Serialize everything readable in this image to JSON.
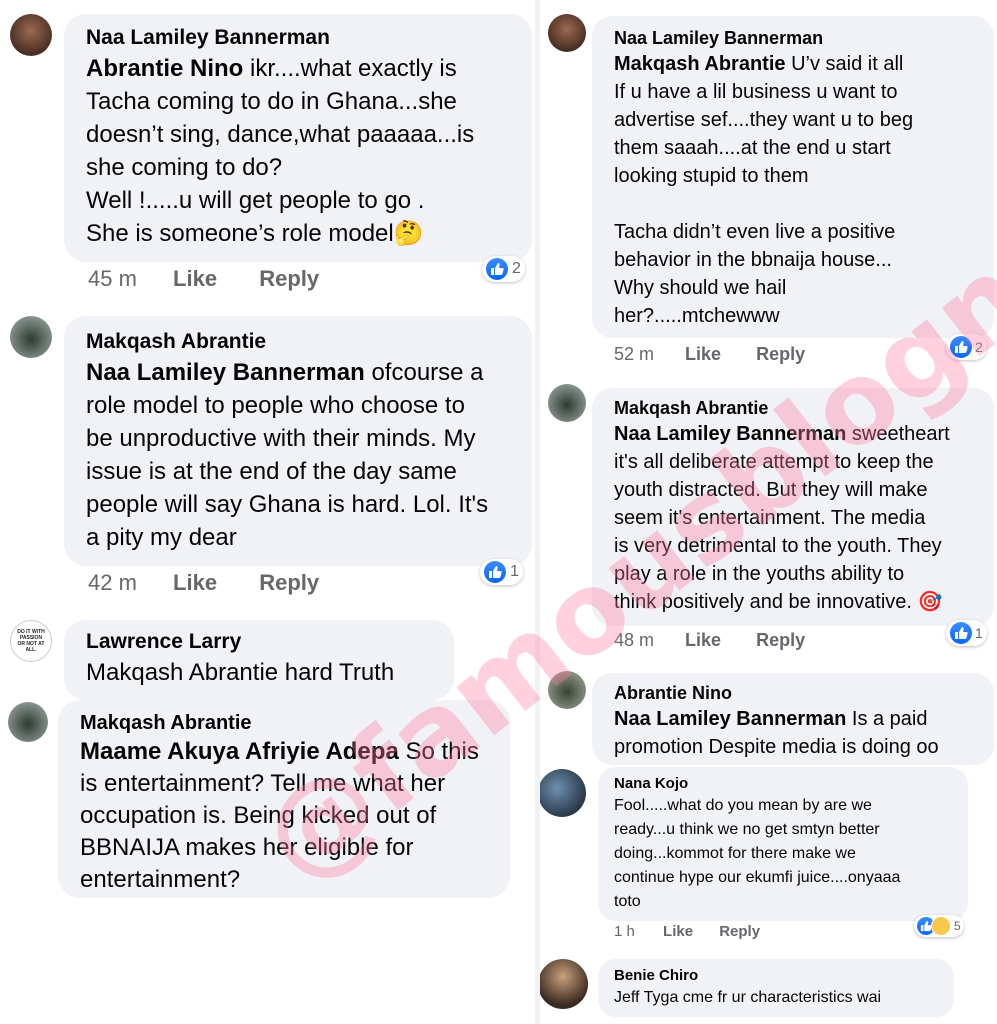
{
  "left": {
    "c1": {
      "author": "Naa Lamiley Bannerman",
      "mention": "Abrantie Nino",
      "text": " ikr....what exactly is\nTacha coming to do in Ghana...she\ndoesn’t sing, dance,what paaaaa...is\nshe coming to do?\nWell !.....u will get people to go .\nShe is someone’s role model🤔",
      "time": "45 m",
      "like": "Like",
      "reply": "Reply",
      "reactions": "2"
    },
    "c2": {
      "author": "Makqash Abrantie",
      "mention": "Naa Lamiley Bannerman",
      "text": " ofcourse a\nrole model to people who choose to\nbe unproductive with their minds. My\nissue is at the end of the day same\npeople will say Ghana is hard. Lol. It's\na pity my dear",
      "time": "42 m",
      "like": "Like",
      "reply": "Reply",
      "reactions": "1"
    },
    "c3": {
      "author": "Lawrence Larry",
      "text": "Makqash Abrantie hard Truth",
      "avatar_text": "DO IT WITH PASSION OR NOT AT ALL."
    },
    "c4": {
      "author": "Makqash Abrantie",
      "mention": "Maame Akuya Afriyie Adepa",
      "text": " So this\nis entertainment? Tell me what her\noccupation is. Being kicked out of\nBBNAIJA makes her eligible for\nentertainment?"
    }
  },
  "right": {
    "c1": {
      "author": "Naa Lamiley Bannerman",
      "mention": "Makqash Abrantie",
      "text": " U’v said it all\nIf u have a lil business u want to\nadvertise sef....they want u to beg\nthem saaah....at the end u start\nlooking stupid to them\n\nTacha didn’t even live a positive\nbehavior in the bbnaija house...\nWhy should we hail\nher?.....mtchewww",
      "time": "52 m",
      "like": "Like",
      "reply": "Reply",
      "reactions": "2"
    },
    "c2": {
      "author": "Makqash Abrantie",
      "mention": "Naa Lamiley Bannerman",
      "text": " sweetheart\nit's all deliberate attempt to keep the\nyouth distracted. But they will make\nseem it's entertainment. The media\nis very detrimental to the youth. They\nplay a role in the youths ability to\nthink positively and be innovative. 🎯",
      "time": "48 m",
      "like": "Like",
      "reply": "Reply",
      "reactions": "1"
    },
    "c3": {
      "author": "Abrantie Nino",
      "mention": "Naa Lamiley Bannerman",
      "text": " Is a paid\npromotion Despite media is doing oo"
    },
    "c4": {
      "author": "Nana Kojo",
      "text": "Fool.....what do you mean by are we\nready...u think we no get smtyn better\ndoing...kommot for there make we\ncontinue hype our ekumfi juice....onyaaa\ntoto",
      "time": "1 h",
      "like": "Like",
      "reply": "Reply",
      "reactions": "5"
    },
    "c5": {
      "author": "Benie Chiro",
      "text": "Jeff Tyga cme fr ur characteristics wai"
    }
  },
  "watermark": "@famousblogng",
  "colors": {
    "bubble": "#f0f2f5",
    "meta": "#65676b",
    "like_blue": "#0866ff",
    "watermark": "#ff78a0"
  }
}
